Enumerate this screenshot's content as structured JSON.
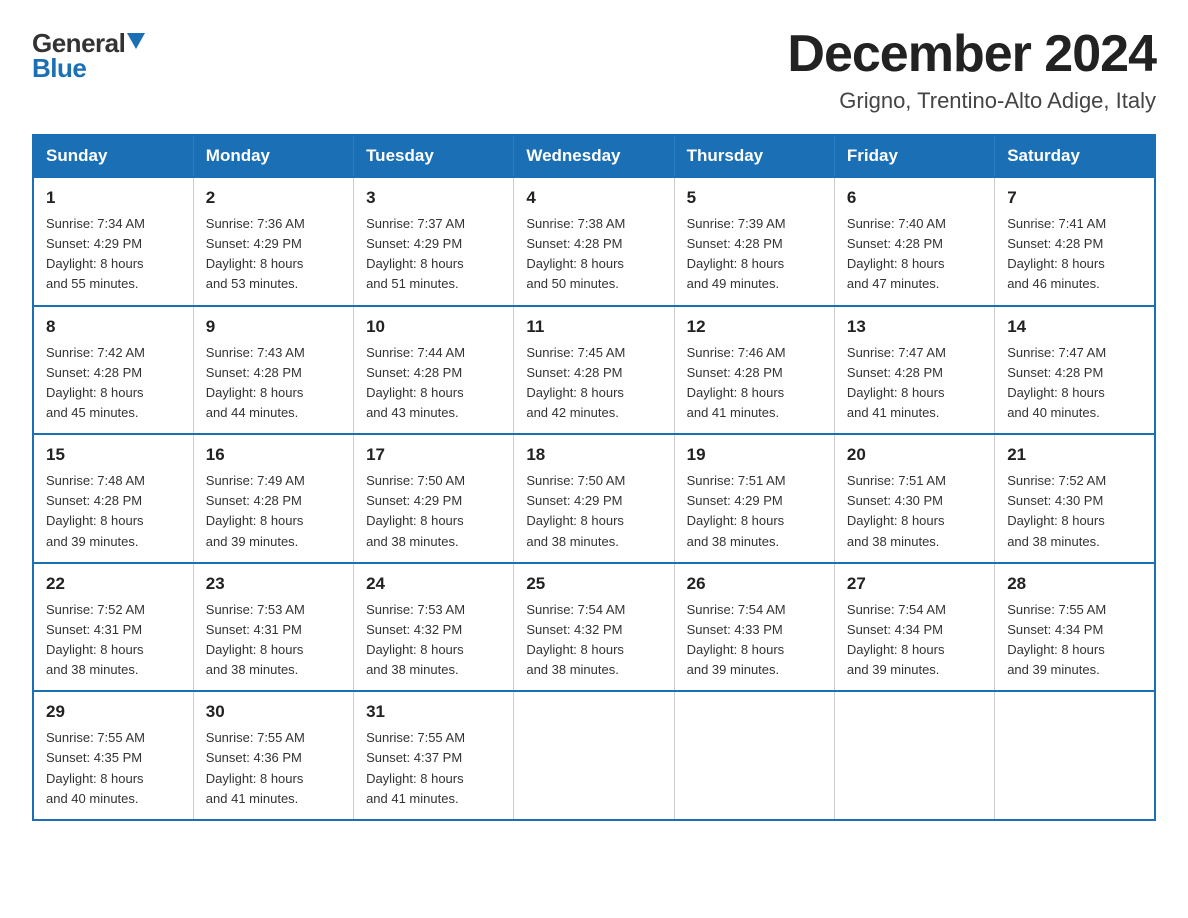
{
  "logo": {
    "general": "General",
    "blue": "Blue"
  },
  "title": "December 2024",
  "subtitle": "Grigno, Trentino-Alto Adige, Italy",
  "days_of_week": [
    "Sunday",
    "Monday",
    "Tuesday",
    "Wednesday",
    "Thursday",
    "Friday",
    "Saturday"
  ],
  "weeks": [
    [
      {
        "day": "1",
        "sunrise": "Sunrise: 7:34 AM",
        "sunset": "Sunset: 4:29 PM",
        "daylight": "Daylight: 8 hours",
        "daylight2": "and 55 minutes."
      },
      {
        "day": "2",
        "sunrise": "Sunrise: 7:36 AM",
        "sunset": "Sunset: 4:29 PM",
        "daylight": "Daylight: 8 hours",
        "daylight2": "and 53 minutes."
      },
      {
        "day": "3",
        "sunrise": "Sunrise: 7:37 AM",
        "sunset": "Sunset: 4:29 PM",
        "daylight": "Daylight: 8 hours",
        "daylight2": "and 51 minutes."
      },
      {
        "day": "4",
        "sunrise": "Sunrise: 7:38 AM",
        "sunset": "Sunset: 4:28 PM",
        "daylight": "Daylight: 8 hours",
        "daylight2": "and 50 minutes."
      },
      {
        "day": "5",
        "sunrise": "Sunrise: 7:39 AM",
        "sunset": "Sunset: 4:28 PM",
        "daylight": "Daylight: 8 hours",
        "daylight2": "and 49 minutes."
      },
      {
        "day": "6",
        "sunrise": "Sunrise: 7:40 AM",
        "sunset": "Sunset: 4:28 PM",
        "daylight": "Daylight: 8 hours",
        "daylight2": "and 47 minutes."
      },
      {
        "day": "7",
        "sunrise": "Sunrise: 7:41 AM",
        "sunset": "Sunset: 4:28 PM",
        "daylight": "Daylight: 8 hours",
        "daylight2": "and 46 minutes."
      }
    ],
    [
      {
        "day": "8",
        "sunrise": "Sunrise: 7:42 AM",
        "sunset": "Sunset: 4:28 PM",
        "daylight": "Daylight: 8 hours",
        "daylight2": "and 45 minutes."
      },
      {
        "day": "9",
        "sunrise": "Sunrise: 7:43 AM",
        "sunset": "Sunset: 4:28 PM",
        "daylight": "Daylight: 8 hours",
        "daylight2": "and 44 minutes."
      },
      {
        "day": "10",
        "sunrise": "Sunrise: 7:44 AM",
        "sunset": "Sunset: 4:28 PM",
        "daylight": "Daylight: 8 hours",
        "daylight2": "and 43 minutes."
      },
      {
        "day": "11",
        "sunrise": "Sunrise: 7:45 AM",
        "sunset": "Sunset: 4:28 PM",
        "daylight": "Daylight: 8 hours",
        "daylight2": "and 42 minutes."
      },
      {
        "day": "12",
        "sunrise": "Sunrise: 7:46 AM",
        "sunset": "Sunset: 4:28 PM",
        "daylight": "Daylight: 8 hours",
        "daylight2": "and 41 minutes."
      },
      {
        "day": "13",
        "sunrise": "Sunrise: 7:47 AM",
        "sunset": "Sunset: 4:28 PM",
        "daylight": "Daylight: 8 hours",
        "daylight2": "and 41 minutes."
      },
      {
        "day": "14",
        "sunrise": "Sunrise: 7:47 AM",
        "sunset": "Sunset: 4:28 PM",
        "daylight": "Daylight: 8 hours",
        "daylight2": "and 40 minutes."
      }
    ],
    [
      {
        "day": "15",
        "sunrise": "Sunrise: 7:48 AM",
        "sunset": "Sunset: 4:28 PM",
        "daylight": "Daylight: 8 hours",
        "daylight2": "and 39 minutes."
      },
      {
        "day": "16",
        "sunrise": "Sunrise: 7:49 AM",
        "sunset": "Sunset: 4:28 PM",
        "daylight": "Daylight: 8 hours",
        "daylight2": "and 39 minutes."
      },
      {
        "day": "17",
        "sunrise": "Sunrise: 7:50 AM",
        "sunset": "Sunset: 4:29 PM",
        "daylight": "Daylight: 8 hours",
        "daylight2": "and 38 minutes."
      },
      {
        "day": "18",
        "sunrise": "Sunrise: 7:50 AM",
        "sunset": "Sunset: 4:29 PM",
        "daylight": "Daylight: 8 hours",
        "daylight2": "and 38 minutes."
      },
      {
        "day": "19",
        "sunrise": "Sunrise: 7:51 AM",
        "sunset": "Sunset: 4:29 PM",
        "daylight": "Daylight: 8 hours",
        "daylight2": "and 38 minutes."
      },
      {
        "day": "20",
        "sunrise": "Sunrise: 7:51 AM",
        "sunset": "Sunset: 4:30 PM",
        "daylight": "Daylight: 8 hours",
        "daylight2": "and 38 minutes."
      },
      {
        "day": "21",
        "sunrise": "Sunrise: 7:52 AM",
        "sunset": "Sunset: 4:30 PM",
        "daylight": "Daylight: 8 hours",
        "daylight2": "and 38 minutes."
      }
    ],
    [
      {
        "day": "22",
        "sunrise": "Sunrise: 7:52 AM",
        "sunset": "Sunset: 4:31 PM",
        "daylight": "Daylight: 8 hours",
        "daylight2": "and 38 minutes."
      },
      {
        "day": "23",
        "sunrise": "Sunrise: 7:53 AM",
        "sunset": "Sunset: 4:31 PM",
        "daylight": "Daylight: 8 hours",
        "daylight2": "and 38 minutes."
      },
      {
        "day": "24",
        "sunrise": "Sunrise: 7:53 AM",
        "sunset": "Sunset: 4:32 PM",
        "daylight": "Daylight: 8 hours",
        "daylight2": "and 38 minutes."
      },
      {
        "day": "25",
        "sunrise": "Sunrise: 7:54 AM",
        "sunset": "Sunset: 4:32 PM",
        "daylight": "Daylight: 8 hours",
        "daylight2": "and 38 minutes."
      },
      {
        "day": "26",
        "sunrise": "Sunrise: 7:54 AM",
        "sunset": "Sunset: 4:33 PM",
        "daylight": "Daylight: 8 hours",
        "daylight2": "and 39 minutes."
      },
      {
        "day": "27",
        "sunrise": "Sunrise: 7:54 AM",
        "sunset": "Sunset: 4:34 PM",
        "daylight": "Daylight: 8 hours",
        "daylight2": "and 39 minutes."
      },
      {
        "day": "28",
        "sunrise": "Sunrise: 7:55 AM",
        "sunset": "Sunset: 4:34 PM",
        "daylight": "Daylight: 8 hours",
        "daylight2": "and 39 minutes."
      }
    ],
    [
      {
        "day": "29",
        "sunrise": "Sunrise: 7:55 AM",
        "sunset": "Sunset: 4:35 PM",
        "daylight": "Daylight: 8 hours",
        "daylight2": "and 40 minutes."
      },
      {
        "day": "30",
        "sunrise": "Sunrise: 7:55 AM",
        "sunset": "Sunset: 4:36 PM",
        "daylight": "Daylight: 8 hours",
        "daylight2": "and 41 minutes."
      },
      {
        "day": "31",
        "sunrise": "Sunrise: 7:55 AM",
        "sunset": "Sunset: 4:37 PM",
        "daylight": "Daylight: 8 hours",
        "daylight2": "and 41 minutes."
      },
      null,
      null,
      null,
      null
    ]
  ]
}
